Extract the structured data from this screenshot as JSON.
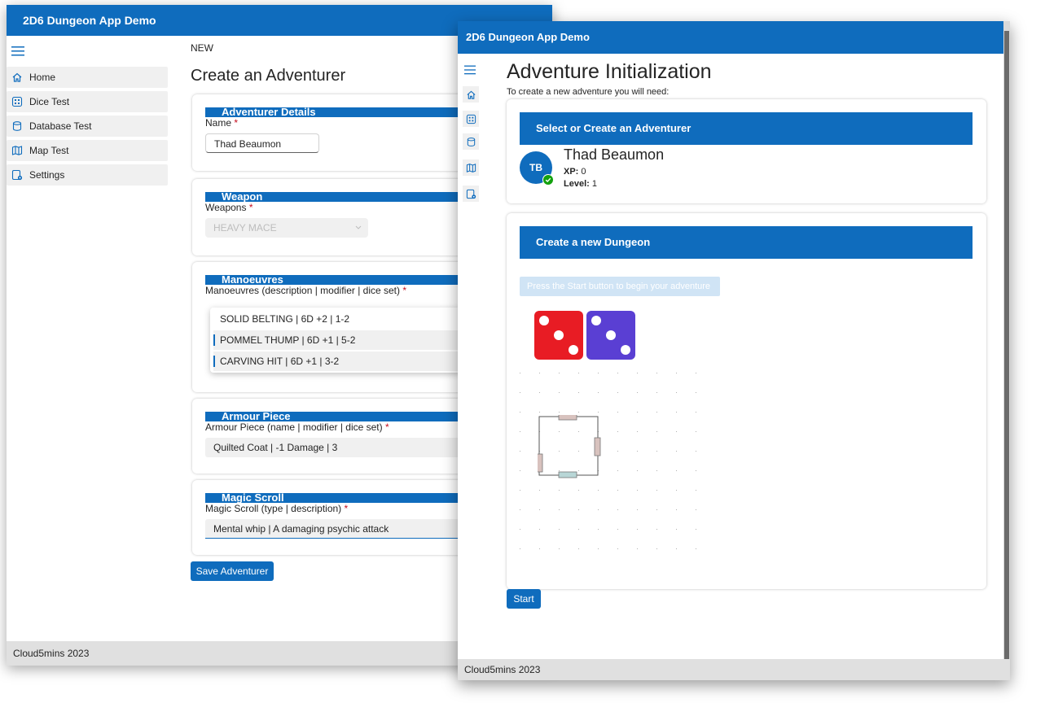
{
  "left_window": {
    "app_title": "2D6 Dungeon App Demo",
    "nav": [
      {
        "label": "Home"
      },
      {
        "label": "Dice Test"
      },
      {
        "label": "Database Test"
      },
      {
        "label": "Map Test"
      },
      {
        "label": "Settings"
      }
    ],
    "breadcrumb": "NEW",
    "page_title": "Create an Adventurer",
    "sections": {
      "details": {
        "header": "Adventurer Details",
        "field_label": "Name",
        "value": "Thad Beaumon"
      },
      "weapon": {
        "header": "Weapon",
        "field_label": "Weapons",
        "value": "HEAVY MACE"
      },
      "manoeuvres": {
        "header": "Manoeuvres",
        "field_label": "Manoeuvres (description | modifier | dice set)",
        "options": [
          {
            "label": "SOLID BELTING | 6D +2 | 1-2",
            "selected": false
          },
          {
            "label": "POMMEL THUMP | 6D +1 | 5-2",
            "selected": true
          },
          {
            "label": "CARVING HIT | 6D +1 | 3-2",
            "selected": true
          }
        ]
      },
      "armour": {
        "header": "Armour Piece",
        "field_label": "Armour Piece (name | modifier | dice set)",
        "value": "Quilted Coat | -1 Damage | 3"
      },
      "scroll": {
        "header": "Magic Scroll",
        "field_label": "Magic Scroll (type | description)",
        "value": "Mental whip | A damaging psychic attack"
      }
    },
    "required_mark": "*",
    "save_button": "Save Adventurer",
    "footer": "Cloud5mins 2023"
  },
  "right_window": {
    "app_title": "2D6 Dungeon App Demo",
    "page_title": "Adventure Initialization",
    "subtitle": "To create a new adventure you will need:",
    "adventurer_card": {
      "header": "Select or Create an Adventurer",
      "avatar_initials": "TB",
      "name": "Thad Beaumon",
      "xp_label": "XP:",
      "xp_value": "0",
      "level_label": "Level:",
      "level_value": "1"
    },
    "dungeon_card": {
      "header": "Create a new Dungeon",
      "hint_button": "Press the Start button to begin your adventure",
      "dice": [
        {
          "value": 3,
          "color": "#e81c24"
        },
        {
          "value": 3,
          "color": "#5a3fd3"
        }
      ]
    },
    "start_button": "Start",
    "footer": "Cloud5mins 2023"
  },
  "colors": {
    "brand": "#0f6cbd",
    "status_online": "#13a10e"
  }
}
